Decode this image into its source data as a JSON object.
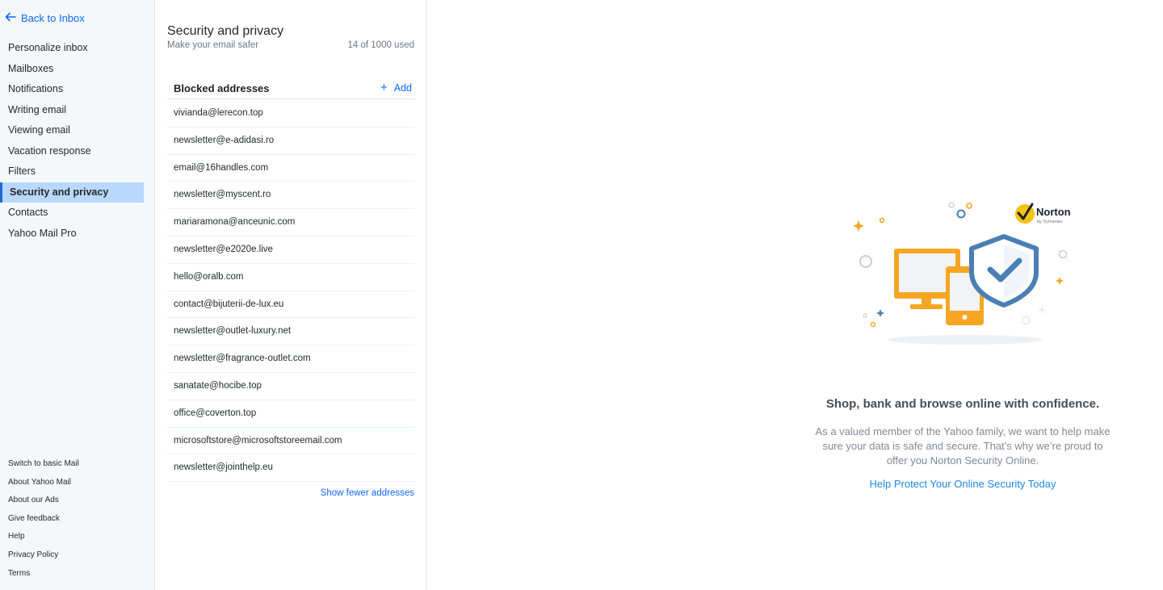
{
  "sidebar": {
    "back_label": "Back to Inbox",
    "items": [
      {
        "label": "Personalize inbox"
      },
      {
        "label": "Mailboxes"
      },
      {
        "label": "Notifications"
      },
      {
        "label": "Writing email"
      },
      {
        "label": "Viewing email"
      },
      {
        "label": "Vacation response"
      },
      {
        "label": "Filters"
      },
      {
        "label": "Security and privacy",
        "active": true
      },
      {
        "label": "Contacts"
      },
      {
        "label": "Yahoo Mail Pro"
      }
    ],
    "footer": [
      "Switch to basic Mail",
      "About Yahoo Mail",
      "About our Ads",
      "Give feedback",
      "Help",
      "Privacy Policy",
      "Terms"
    ]
  },
  "panel": {
    "title": "Security and privacy",
    "subtitle": "Make your email safer",
    "usage": "14 of 1000 used",
    "blocked_title": "Blocked addresses",
    "add_label": "Add",
    "addresses": [
      "vivianda@lerecon.top",
      "newsletter@e-adidasi.ro",
      "email@16handles.com",
      "newsletter@myscent.ro",
      "mariaramona@anceunic.com",
      "newsletter@e2020e.live",
      "hello@oralb.com",
      "contact@bijuterii-de-lux.eu",
      "newsletter@outlet-luxury.net",
      "newsletter@fragrance-outlet.com",
      "sanatate@hocibe.top",
      "office@coverton.top",
      "microsoftstore@microsoftstoreemail.com",
      "newsletter@jointhelp.eu"
    ],
    "show_fewer": "Show fewer addresses"
  },
  "promo": {
    "norton_logo_text": "Norton",
    "norton_logo_sub": "by Symantec",
    "headline": "Shop, bank and browse online with confidence.",
    "body": "As a valued member of the Yahoo family, we want to help make sure your data is safe and secure. That’s why we’re proud to offer you Norton Security Online.",
    "link": "Help Protect Your Online Security Today"
  },
  "colors": {
    "accent": "#0f69ff",
    "active_bg": "#b9d8fb",
    "illus_orange": "#f5a623",
    "illus_blue": "#4a7fb5"
  },
  "icons": {
    "back": "arrow-left-icon",
    "add": "plus-icon"
  }
}
